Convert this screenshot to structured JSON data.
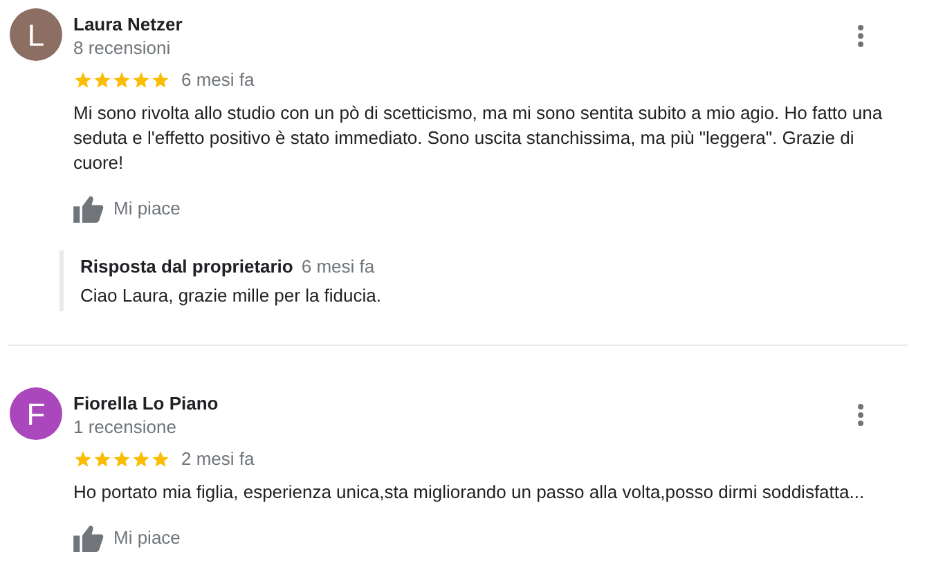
{
  "reviews": [
    {
      "avatar_letter": "L",
      "color": "#8d6e63",
      "name": "Laura Netzer",
      "review_count": "8 recensioni",
      "stars": 5,
      "time": "6 mesi fa",
      "text": "Mi sono rivolta allo studio con un pò di scetticismo, ma mi sono sentita subito a mio agio. Ho fatto una seduta e l'effetto positivo è stato immediato. Sono uscita stanchissima, ma più \"leggera\". Grazie di cuore!",
      "like_label": "Mi piace",
      "owner_reply": {
        "title": "Risposta dal proprietario",
        "time": "6 mesi fa",
        "text": "Ciao Laura, grazie mille per la fiducia."
      }
    },
    {
      "avatar_letter": "F",
      "color": "#ab47bc",
      "name": "Fiorella Lo Piano",
      "review_count": "1 recensione",
      "stars": 5,
      "time": "2 mesi fa",
      "text": "Ho portato mia figlia, esperienza unica,sta migliorando un passo alla volta,posso dirmi soddisfatta...",
      "like_label": "Mi piace"
    }
  ]
}
